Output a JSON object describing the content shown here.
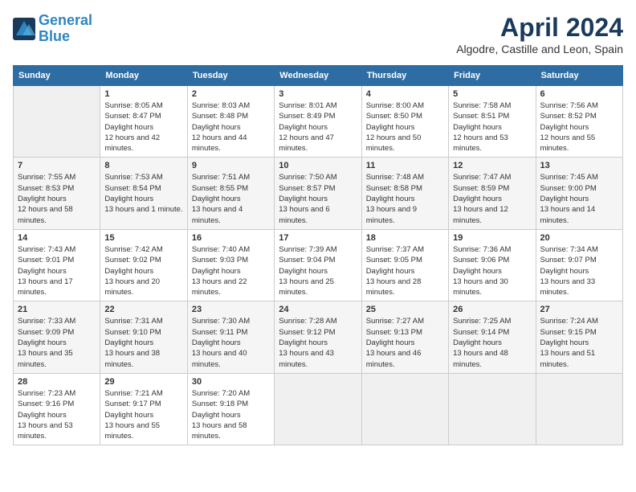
{
  "header": {
    "logo_line1": "General",
    "logo_line2": "Blue",
    "month_title": "April 2024",
    "location": "Algodre, Castille and Leon, Spain"
  },
  "weekdays": [
    "Sunday",
    "Monday",
    "Tuesday",
    "Wednesday",
    "Thursday",
    "Friday",
    "Saturday"
  ],
  "weeks": [
    [
      {
        "day": null
      },
      {
        "day": 1,
        "sunrise": "8:05 AM",
        "sunset": "8:47 PM",
        "daylight": "12 hours and 42 minutes."
      },
      {
        "day": 2,
        "sunrise": "8:03 AM",
        "sunset": "8:48 PM",
        "daylight": "12 hours and 44 minutes."
      },
      {
        "day": 3,
        "sunrise": "8:01 AM",
        "sunset": "8:49 PM",
        "daylight": "12 hours and 47 minutes."
      },
      {
        "day": 4,
        "sunrise": "8:00 AM",
        "sunset": "8:50 PM",
        "daylight": "12 hours and 50 minutes."
      },
      {
        "day": 5,
        "sunrise": "7:58 AM",
        "sunset": "8:51 PM",
        "daylight": "12 hours and 53 minutes."
      },
      {
        "day": 6,
        "sunrise": "7:56 AM",
        "sunset": "8:52 PM",
        "daylight": "12 hours and 55 minutes."
      }
    ],
    [
      {
        "day": 7,
        "sunrise": "7:55 AM",
        "sunset": "8:53 PM",
        "daylight": "12 hours and 58 minutes."
      },
      {
        "day": 8,
        "sunrise": "7:53 AM",
        "sunset": "8:54 PM",
        "daylight": "13 hours and 1 minute."
      },
      {
        "day": 9,
        "sunrise": "7:51 AM",
        "sunset": "8:55 PM",
        "daylight": "13 hours and 4 minutes."
      },
      {
        "day": 10,
        "sunrise": "7:50 AM",
        "sunset": "8:57 PM",
        "daylight": "13 hours and 6 minutes."
      },
      {
        "day": 11,
        "sunrise": "7:48 AM",
        "sunset": "8:58 PM",
        "daylight": "13 hours and 9 minutes."
      },
      {
        "day": 12,
        "sunrise": "7:47 AM",
        "sunset": "8:59 PM",
        "daylight": "13 hours and 12 minutes."
      },
      {
        "day": 13,
        "sunrise": "7:45 AM",
        "sunset": "9:00 PM",
        "daylight": "13 hours and 14 minutes."
      }
    ],
    [
      {
        "day": 14,
        "sunrise": "7:43 AM",
        "sunset": "9:01 PM",
        "daylight": "13 hours and 17 minutes."
      },
      {
        "day": 15,
        "sunrise": "7:42 AM",
        "sunset": "9:02 PM",
        "daylight": "13 hours and 20 minutes."
      },
      {
        "day": 16,
        "sunrise": "7:40 AM",
        "sunset": "9:03 PM",
        "daylight": "13 hours and 22 minutes."
      },
      {
        "day": 17,
        "sunrise": "7:39 AM",
        "sunset": "9:04 PM",
        "daylight": "13 hours and 25 minutes."
      },
      {
        "day": 18,
        "sunrise": "7:37 AM",
        "sunset": "9:05 PM",
        "daylight": "13 hours and 28 minutes."
      },
      {
        "day": 19,
        "sunrise": "7:36 AM",
        "sunset": "9:06 PM",
        "daylight": "13 hours and 30 minutes."
      },
      {
        "day": 20,
        "sunrise": "7:34 AM",
        "sunset": "9:07 PM",
        "daylight": "13 hours and 33 minutes."
      }
    ],
    [
      {
        "day": 21,
        "sunrise": "7:33 AM",
        "sunset": "9:09 PM",
        "daylight": "13 hours and 35 minutes."
      },
      {
        "day": 22,
        "sunrise": "7:31 AM",
        "sunset": "9:10 PM",
        "daylight": "13 hours and 38 minutes."
      },
      {
        "day": 23,
        "sunrise": "7:30 AM",
        "sunset": "9:11 PM",
        "daylight": "13 hours and 40 minutes."
      },
      {
        "day": 24,
        "sunrise": "7:28 AM",
        "sunset": "9:12 PM",
        "daylight": "13 hours and 43 minutes."
      },
      {
        "day": 25,
        "sunrise": "7:27 AM",
        "sunset": "9:13 PM",
        "daylight": "13 hours and 46 minutes."
      },
      {
        "day": 26,
        "sunrise": "7:25 AM",
        "sunset": "9:14 PM",
        "daylight": "13 hours and 48 minutes."
      },
      {
        "day": 27,
        "sunrise": "7:24 AM",
        "sunset": "9:15 PM",
        "daylight": "13 hours and 51 minutes."
      }
    ],
    [
      {
        "day": 28,
        "sunrise": "7:23 AM",
        "sunset": "9:16 PM",
        "daylight": "13 hours and 53 minutes."
      },
      {
        "day": 29,
        "sunrise": "7:21 AM",
        "sunset": "9:17 PM",
        "daylight": "13 hours and 55 minutes."
      },
      {
        "day": 30,
        "sunrise": "7:20 AM",
        "sunset": "9:18 PM",
        "daylight": "13 hours and 58 minutes."
      },
      {
        "day": null
      },
      {
        "day": null
      },
      {
        "day": null
      },
      {
        "day": null
      }
    ]
  ]
}
